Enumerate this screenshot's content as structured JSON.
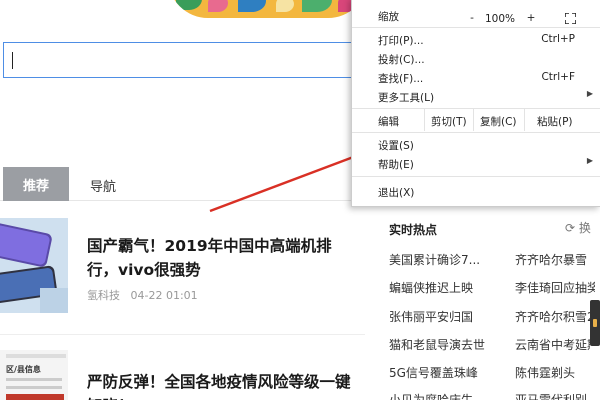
{
  "feed": {
    "tab_active": "推荐",
    "tab_nav": "导航",
    "articles": [
      {
        "title": "国产霸气！2019年中国中高端机排行，vivo很强势",
        "source": "氢科技",
        "time": "04-22 01:01"
      },
      {
        "title": "严防反弹！全国各地疫情风险等级一键知晓！"
      }
    ],
    "thumb2_lines": [
      "区/县信息"
    ]
  },
  "hot": {
    "title": "实时热点",
    "refresh_label": "换",
    "col1": [
      "美国累计确诊7...",
      "蝙蝠侠推迟上映",
      "张伟丽平安归国",
      "猫和老鼠导演去世",
      "5G信号覆盖珠峰",
      "小贝为腐哈庆生"
    ],
    "col2": [
      "齐齐哈尔暴雪",
      "李佳琦回应抽奖",
      "齐齐哈尔积雪2",
      "云南省中考延期",
      "陈伟霆剃头",
      "亚马雷代利别"
    ]
  },
  "menu": {
    "zoom_label": "缩放",
    "zoom_minus": "-",
    "zoom_value": "100%",
    "zoom_plus": "+",
    "items_top": [
      {
        "label": "打印(P)...",
        "shortcut": "Ctrl+P"
      },
      {
        "label": "投射(C)...",
        "shortcut": ""
      },
      {
        "label": "查找(F)...",
        "shortcut": "Ctrl+F"
      },
      {
        "label": "更多工具(L)",
        "shortcut": "",
        "submenu": true
      }
    ],
    "edit": {
      "label": "编辑",
      "cut": "剪切(T)",
      "copy": "复制(C)",
      "paste": "粘贴(P)"
    },
    "items_bottom": [
      {
        "label": "设置(S)",
        "submenu": false
      },
      {
        "label": "帮助(E)",
        "submenu": true
      }
    ],
    "exit": "退出(X)",
    "submenu_glyph": "▶"
  },
  "colors": {
    "arrow": "#d93025",
    "search_border": "#4e8ee5",
    "tab_active_bg": "#9b9ea3"
  }
}
